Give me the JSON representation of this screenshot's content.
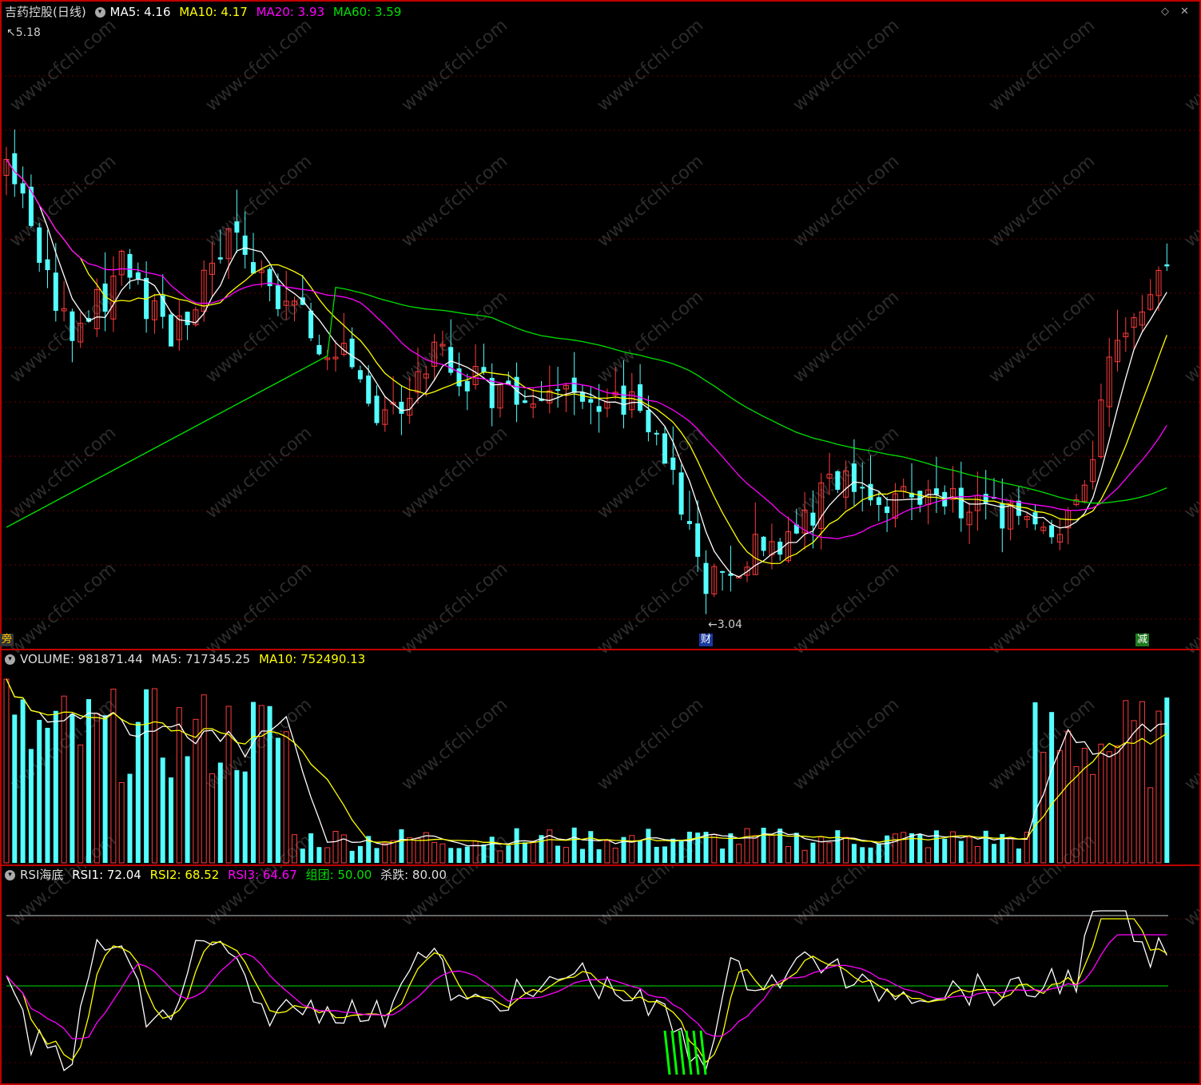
{
  "main_panel": {
    "stock_name": "吉药控股",
    "period": "(日线)",
    "ma5": "MA5: 4.16",
    "ma10": "MA10: 4.17",
    "ma20": "MA20: 3.93",
    "ma60": "MA60: 3.59",
    "high_label": "5.18",
    "low_label": "3.04",
    "tag_left": "旁",
    "tag_mid": "财",
    "tag_right": "减"
  },
  "volume_panel": {
    "volume": "VOLUME: 981871.44",
    "ma5": "MA5: 717345.25",
    "ma10": "MA10: 752490.13"
  },
  "rsi_panel": {
    "name": "RSI海底",
    "rsi1": "RSI1: 72.04",
    "rsi2": "RSI2: 68.52",
    "rsi3": "RSI3: 64.67",
    "group": "组团: 50.00",
    "kill": "杀跌: 80.00"
  },
  "watermark": "www.cfchi.com",
  "colors": {
    "up": "#ff3b3b",
    "down": "#54ffff",
    "ma5": "#ffffff",
    "ma10": "#ffff00",
    "ma20": "#ff00ff",
    "ma60": "#00e000",
    "border": "#c00000"
  },
  "chart_data": {
    "type": "candlestick",
    "price_range": [
      3.04,
      5.18
    ],
    "last": {
      "ma5": 4.16,
      "ma10": 4.17,
      "ma20": 3.93,
      "ma60": 3.59
    },
    "volume": {
      "last": 981871.44,
      "ma5": 717345.25,
      "ma10": 752490.13
    },
    "rsi": {
      "rsi1": 72.04,
      "rsi2": 68.52,
      "rsi3": 64.67,
      "group": 50.0,
      "kill": 80.0
    }
  }
}
